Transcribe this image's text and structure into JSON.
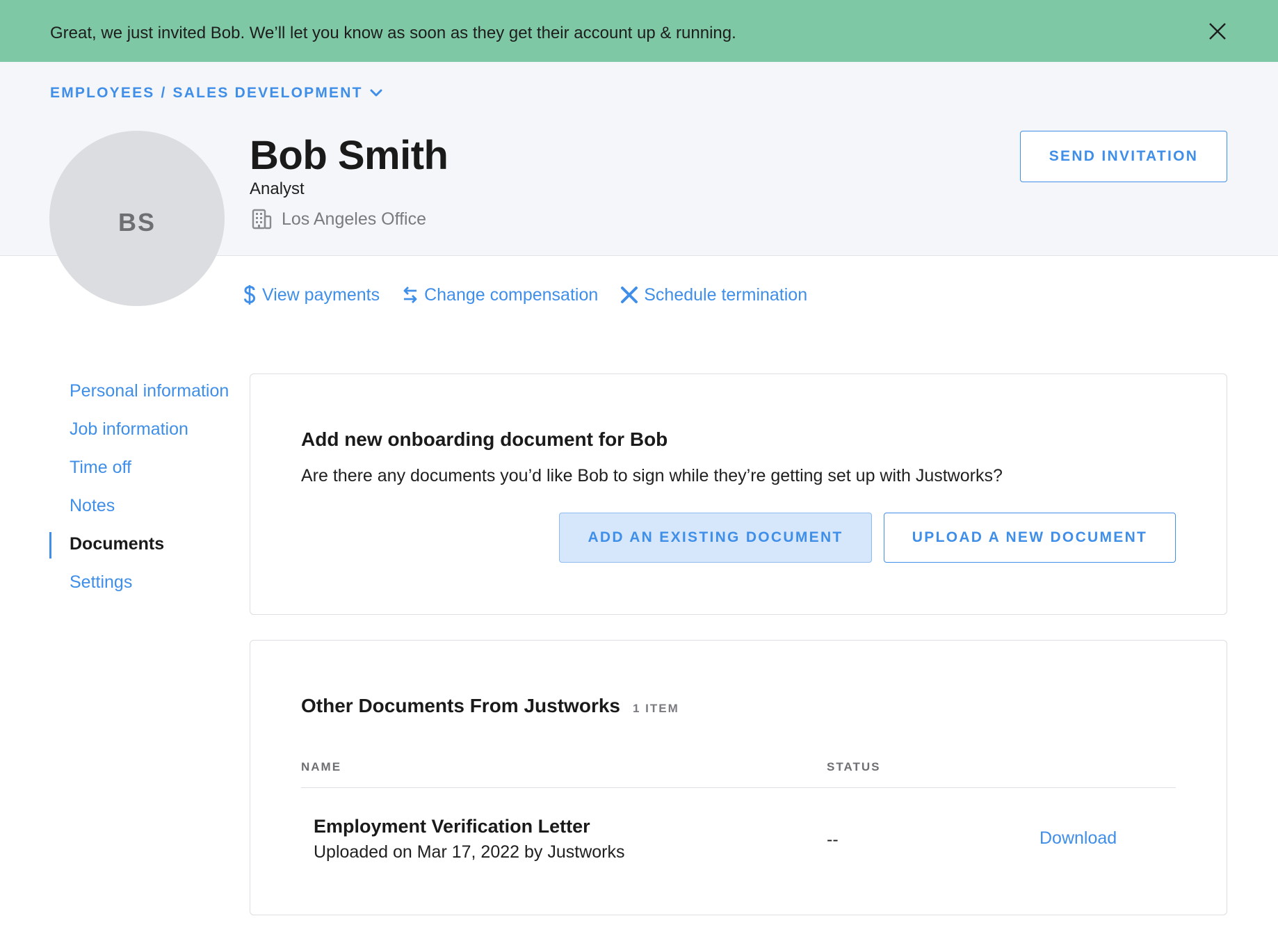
{
  "banner": {
    "message": "Great, we just invited Bob. We’ll let you know as soon as they get their account up & running.",
    "close_icon": "close-icon",
    "color": "#7fc8a5"
  },
  "breadcrumb": {
    "root": "EMPLOYEES",
    "separator": "/",
    "current": "SALES DEVELOPMENT",
    "dropdown_icon": "chevron-down-icon"
  },
  "employee": {
    "initials": "BS",
    "name": "Bob Smith",
    "title": "Analyst",
    "office": "Los Angeles Office",
    "office_icon": "building-icon"
  },
  "header": {
    "send_invitation_label": "SEND INVITATION"
  },
  "actions": [
    {
      "label": "View payments",
      "icon": "dollar-icon"
    },
    {
      "label": "Change compensation",
      "icon": "swap-arrows-icon"
    },
    {
      "label": "Schedule termination",
      "icon": "x-icon"
    }
  ],
  "sidenav": {
    "items": [
      {
        "label": "Personal information",
        "active": false
      },
      {
        "label": "Job information",
        "active": false
      },
      {
        "label": "Time off",
        "active": false
      },
      {
        "label": "Notes",
        "active": false
      },
      {
        "label": "Documents",
        "active": true
      },
      {
        "label": "Settings",
        "active": false
      }
    ]
  },
  "onboarding": {
    "title": "Add new onboarding document for Bob",
    "description": "Are there any documents you’d like Bob to sign while they’re getting set up with Justworks?",
    "add_existing_label": "ADD AN EXISTING DOCUMENT",
    "upload_new_label": "UPLOAD A NEW DOCUMENT"
  },
  "other_documents": {
    "title": "Other Documents From Justworks",
    "count_label": "1 ITEM",
    "columns": {
      "name": "NAME",
      "status": "STATUS"
    },
    "rows": [
      {
        "name": "Employment Verification Letter",
        "meta": "Uploaded on Mar 17, 2022 by Justworks",
        "status": "--",
        "action": "Download"
      }
    ]
  },
  "colors": {
    "accent": "#3f8ee8",
    "banner": "#7fc8a5",
    "header_band": "#f5f6f9",
    "avatar": "#dcdde0"
  }
}
